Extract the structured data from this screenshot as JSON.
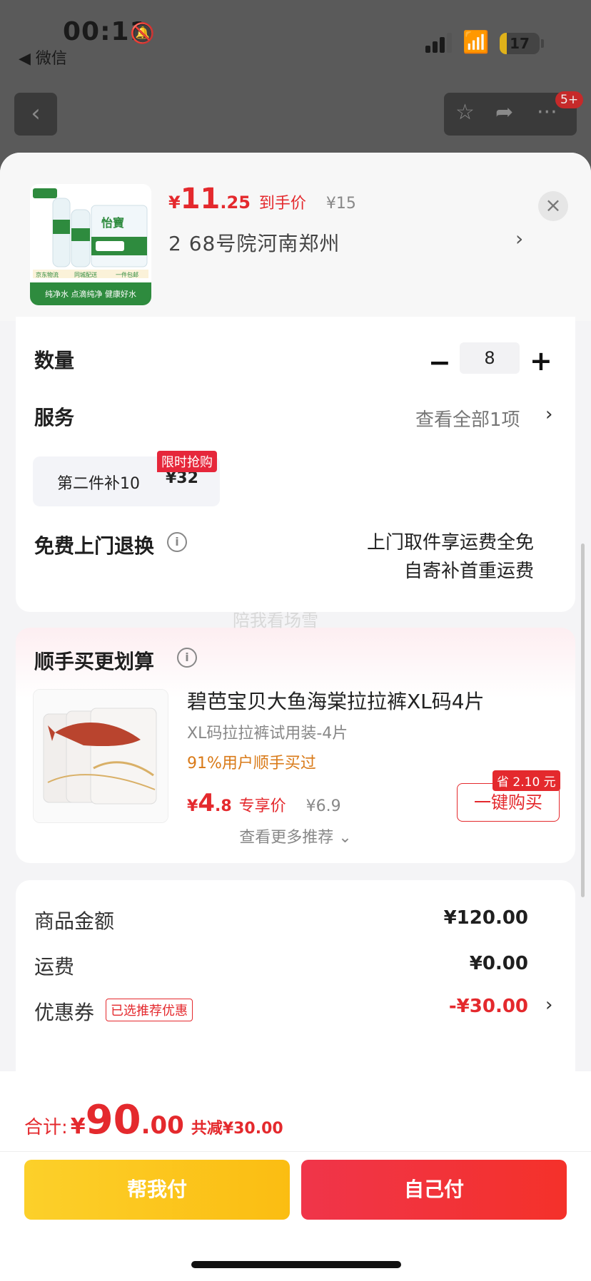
{
  "status_bar": {
    "time": "00:11",
    "back_app": "◀ 微信",
    "battery": "17",
    "battery_level": 0.17
  },
  "nav": {
    "badge": "5+"
  },
  "product": {
    "price_currency": "¥",
    "price_int": "11",
    "price_dec": ".25",
    "price_tag": "到手价",
    "original_price": "¥15",
    "address": "2  68号院河南郑州",
    "image_brand": "怡寶",
    "image_slogan": "纯净水 点滴纯净 健康好水",
    "image_tags": [
      "京东物流",
      "同城配送",
      "一件包邮"
    ]
  },
  "quantity": {
    "label": "数量",
    "value": "8",
    "minus": "−",
    "plus": "+"
  },
  "service": {
    "label": "服务",
    "link": "查看全部1项",
    "chip_name": "第二件补10",
    "chip_price": "¥32",
    "chip_badge": "限时抢购"
  },
  "returns": {
    "label": "免费上门退换",
    "line1": "上门取件享运费全免",
    "line2": "自寄补首重运费"
  },
  "watermark": "陪我看场雪",
  "recommend": {
    "title": "顺手买更划算",
    "name": "碧芭宝贝大鱼海棠拉拉裤XL码4片",
    "subtitle": "XL码拉拉裤试用装-4片",
    "rate": "91%用户顺手买过",
    "price_currency": "¥",
    "price_int": "4",
    "price_dec": ".8",
    "price_tag": "专享价",
    "original_price": "¥6.9",
    "buy_label": "一键购买",
    "save_badge": "省 2.10 元",
    "more": "查看更多推荐 ⌄"
  },
  "summary": {
    "goods_label": "商品金额",
    "goods_value": "¥120.00",
    "shipping_label": "运费",
    "shipping_value": "¥0.00",
    "coupon_label": "优惠券",
    "coupon_tag": "已选推荐优惠",
    "coupon_value": "-¥30.00"
  },
  "footer": {
    "total_label": "合计:",
    "total_currency": "¥",
    "total_int": "90",
    "total_dec": ".00",
    "total_discount": "共减¥30.00",
    "help_pay": "帮我付",
    "self_pay": "自己付"
  },
  "colors": {
    "accent_red": "#e4292d",
    "yellow_button": "#fcd02a",
    "orange_text": "#d97a18"
  }
}
